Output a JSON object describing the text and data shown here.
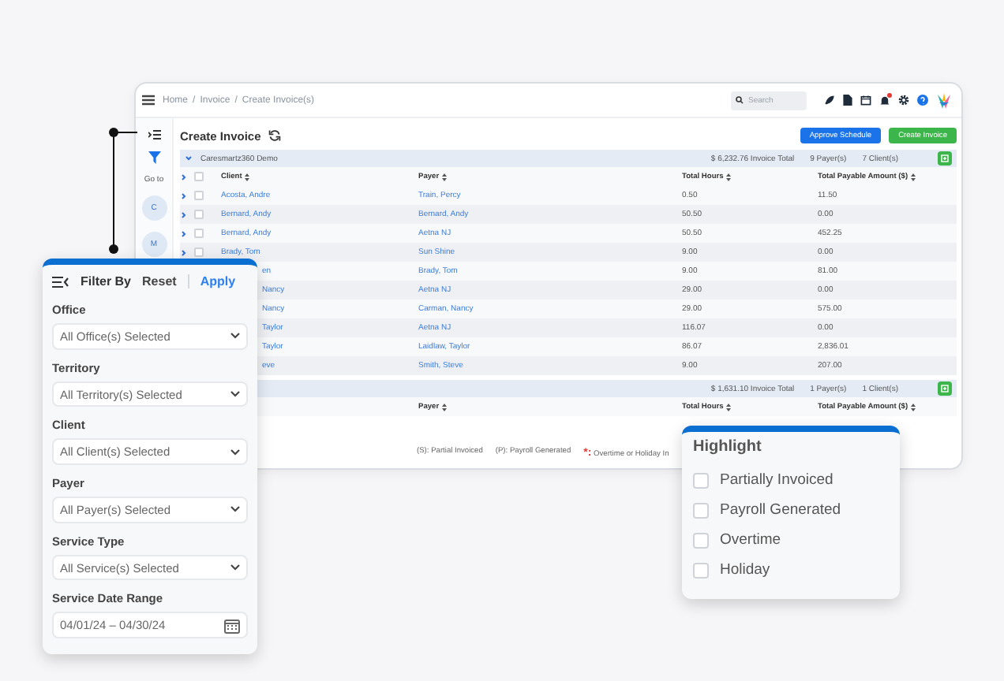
{
  "topbar": {
    "breadcrumb": [
      "Home",
      "Invoice",
      "Create Invoice(s)"
    ],
    "separator": "/",
    "search": {
      "placeholder": "Search"
    },
    "notification_dot": true
  },
  "sidebar": {
    "goto": "Go to",
    "letters": [
      "C",
      "M"
    ]
  },
  "title": "Create Invoice",
  "buttons": [
    {
      "label": "Approve Schedule",
      "kind": "primary"
    },
    {
      "label": "Create Invoice",
      "kind": "success"
    }
  ],
  "columns": [
    "Client",
    "Payer",
    "Total Hours",
    "Total Payable Amount ($)"
  ],
  "header_checked": false,
  "groups": [
    {
      "kind": "full",
      "name": "Caresmartz360 Demo",
      "total": "$ 6,232.76 Invoice Total",
      "payers": "9 Payer(s)",
      "clients": "7 Client(s)",
      "expanded": true,
      "rows": [
        {
          "kind": "full",
          "checked": false,
          "client": "Acosta, Andre",
          "payer": "Train, Percy",
          "hours": "0.50",
          "amount": "11.50"
        },
        {
          "kind": "full",
          "checked": false,
          "client": "Bernard, Andy",
          "payer": "Bernard, Andy",
          "hours": "50.50",
          "amount": "0.00"
        },
        {
          "kind": "full",
          "checked": false,
          "client": "Bernard, Andy",
          "payer": "Aetna NJ",
          "hours": "50.50",
          "amount": "452.25"
        },
        {
          "kind": "full",
          "checked": false,
          "client": "Brady, Tom",
          "payer": "Sun Shine",
          "hours": "9.00",
          "amount": "0.00"
        },
        {
          "kind": "partial",
          "client": "en",
          "payer": "Brady, Tom",
          "hours": "9.00",
          "amount": "81.00"
        },
        {
          "kind": "partial",
          "client": "Nancy",
          "payer": "Aetna NJ",
          "hours": "29.00",
          "amount": "0.00"
        },
        {
          "kind": "partial",
          "client": "Nancy",
          "payer": "Carman, Nancy",
          "hours": "29.00",
          "amount": "575.00"
        },
        {
          "kind": "partial",
          "client": "Taylor",
          "payer": "Aetna NJ",
          "hours": "116.07",
          "amount": "0.00"
        },
        {
          "kind": "partial",
          "client": "Taylor",
          "payer": "Laidlaw, Taylor",
          "hours": "86.07",
          "amount": "2,836.01"
        },
        {
          "kind": "partial",
          "client": "eve",
          "payer": "Smith, Steve",
          "hours": "9.00",
          "amount": "207.00"
        }
      ]
    },
    {
      "kind": "partial",
      "total": "$ 1,631.10 Invoice Total",
      "payers": "1 Payer(s)",
      "clients": "1 Client(s)",
      "columns": [
        "Payer",
        "Total Hours",
        "Total Payable Amount ($)"
      ]
    }
  ],
  "legend": [
    {
      "mark": "(S):",
      "text": "Partial Invoiced"
    },
    {
      "mark": "(P):",
      "text": "Payroll Generated"
    },
    {
      "mark": "*:",
      "text": "Overtime or Holiday In",
      "color": "#e53935"
    }
  ],
  "filter": {
    "title": "Filter By",
    "reset": "Reset",
    "apply": "Apply",
    "fields": [
      {
        "label": "Office",
        "value": "All Office(s) Selected",
        "kind": "select"
      },
      {
        "label": "Territory",
        "value": "All Territory(s) Selected",
        "kind": "select"
      },
      {
        "label": "Client",
        "value": "All Client(s) Selected",
        "kind": "select"
      },
      {
        "label": "Payer",
        "value": "All Payer(s) Selected",
        "kind": "select"
      },
      {
        "label": "Service Type",
        "value": "All Service(s) Selected",
        "kind": "select"
      },
      {
        "label": "Service Date Range",
        "value": "04/01/24 – 04/30/24",
        "kind": "date"
      }
    ]
  },
  "highlight": {
    "title": "Highlight",
    "options": [
      {
        "label": "Partially Invoiced",
        "checked": false
      },
      {
        "label": "Payroll Generated",
        "checked": false
      },
      {
        "label": "Overtime",
        "checked": false
      },
      {
        "label": "Holiday",
        "checked": false
      }
    ]
  }
}
